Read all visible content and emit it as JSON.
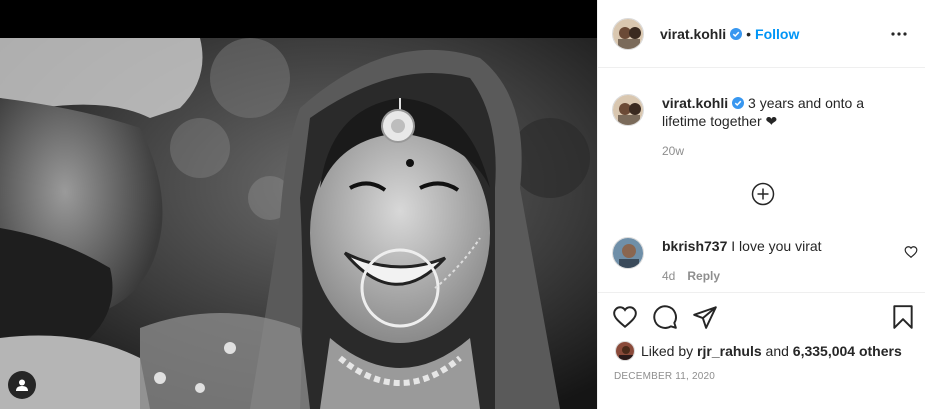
{
  "post": {
    "author": "virat.kohli",
    "follow_label": "Follow",
    "dot": "•",
    "caption_author": "virat.kohli",
    "caption_text": "3 years and onto a lifetime together ❤",
    "caption_time": "20w",
    "comments": [
      {
        "author": "bkrish737",
        "text": "I love you virat",
        "time": "4d",
        "reply_label": "Reply"
      }
    ],
    "likes_prefix": "Liked by",
    "likes_user": "rjr_rahuls",
    "likes_and": "and",
    "likes_others": "6,335,004 others",
    "date": "December 11, 2020"
  },
  "icons": {
    "more": "more-options-icon",
    "verified": "verified-badge-icon",
    "load_more": "load-more-comments-icon",
    "like": "heart-icon",
    "comment": "comment-icon",
    "share": "share-icon",
    "save": "bookmark-icon",
    "tags": "tagged-people-icon"
  },
  "colors": {
    "accent": "#0095f6",
    "verified": "#3897f0",
    "muted": "#8e8e8e",
    "text": "#262626"
  }
}
